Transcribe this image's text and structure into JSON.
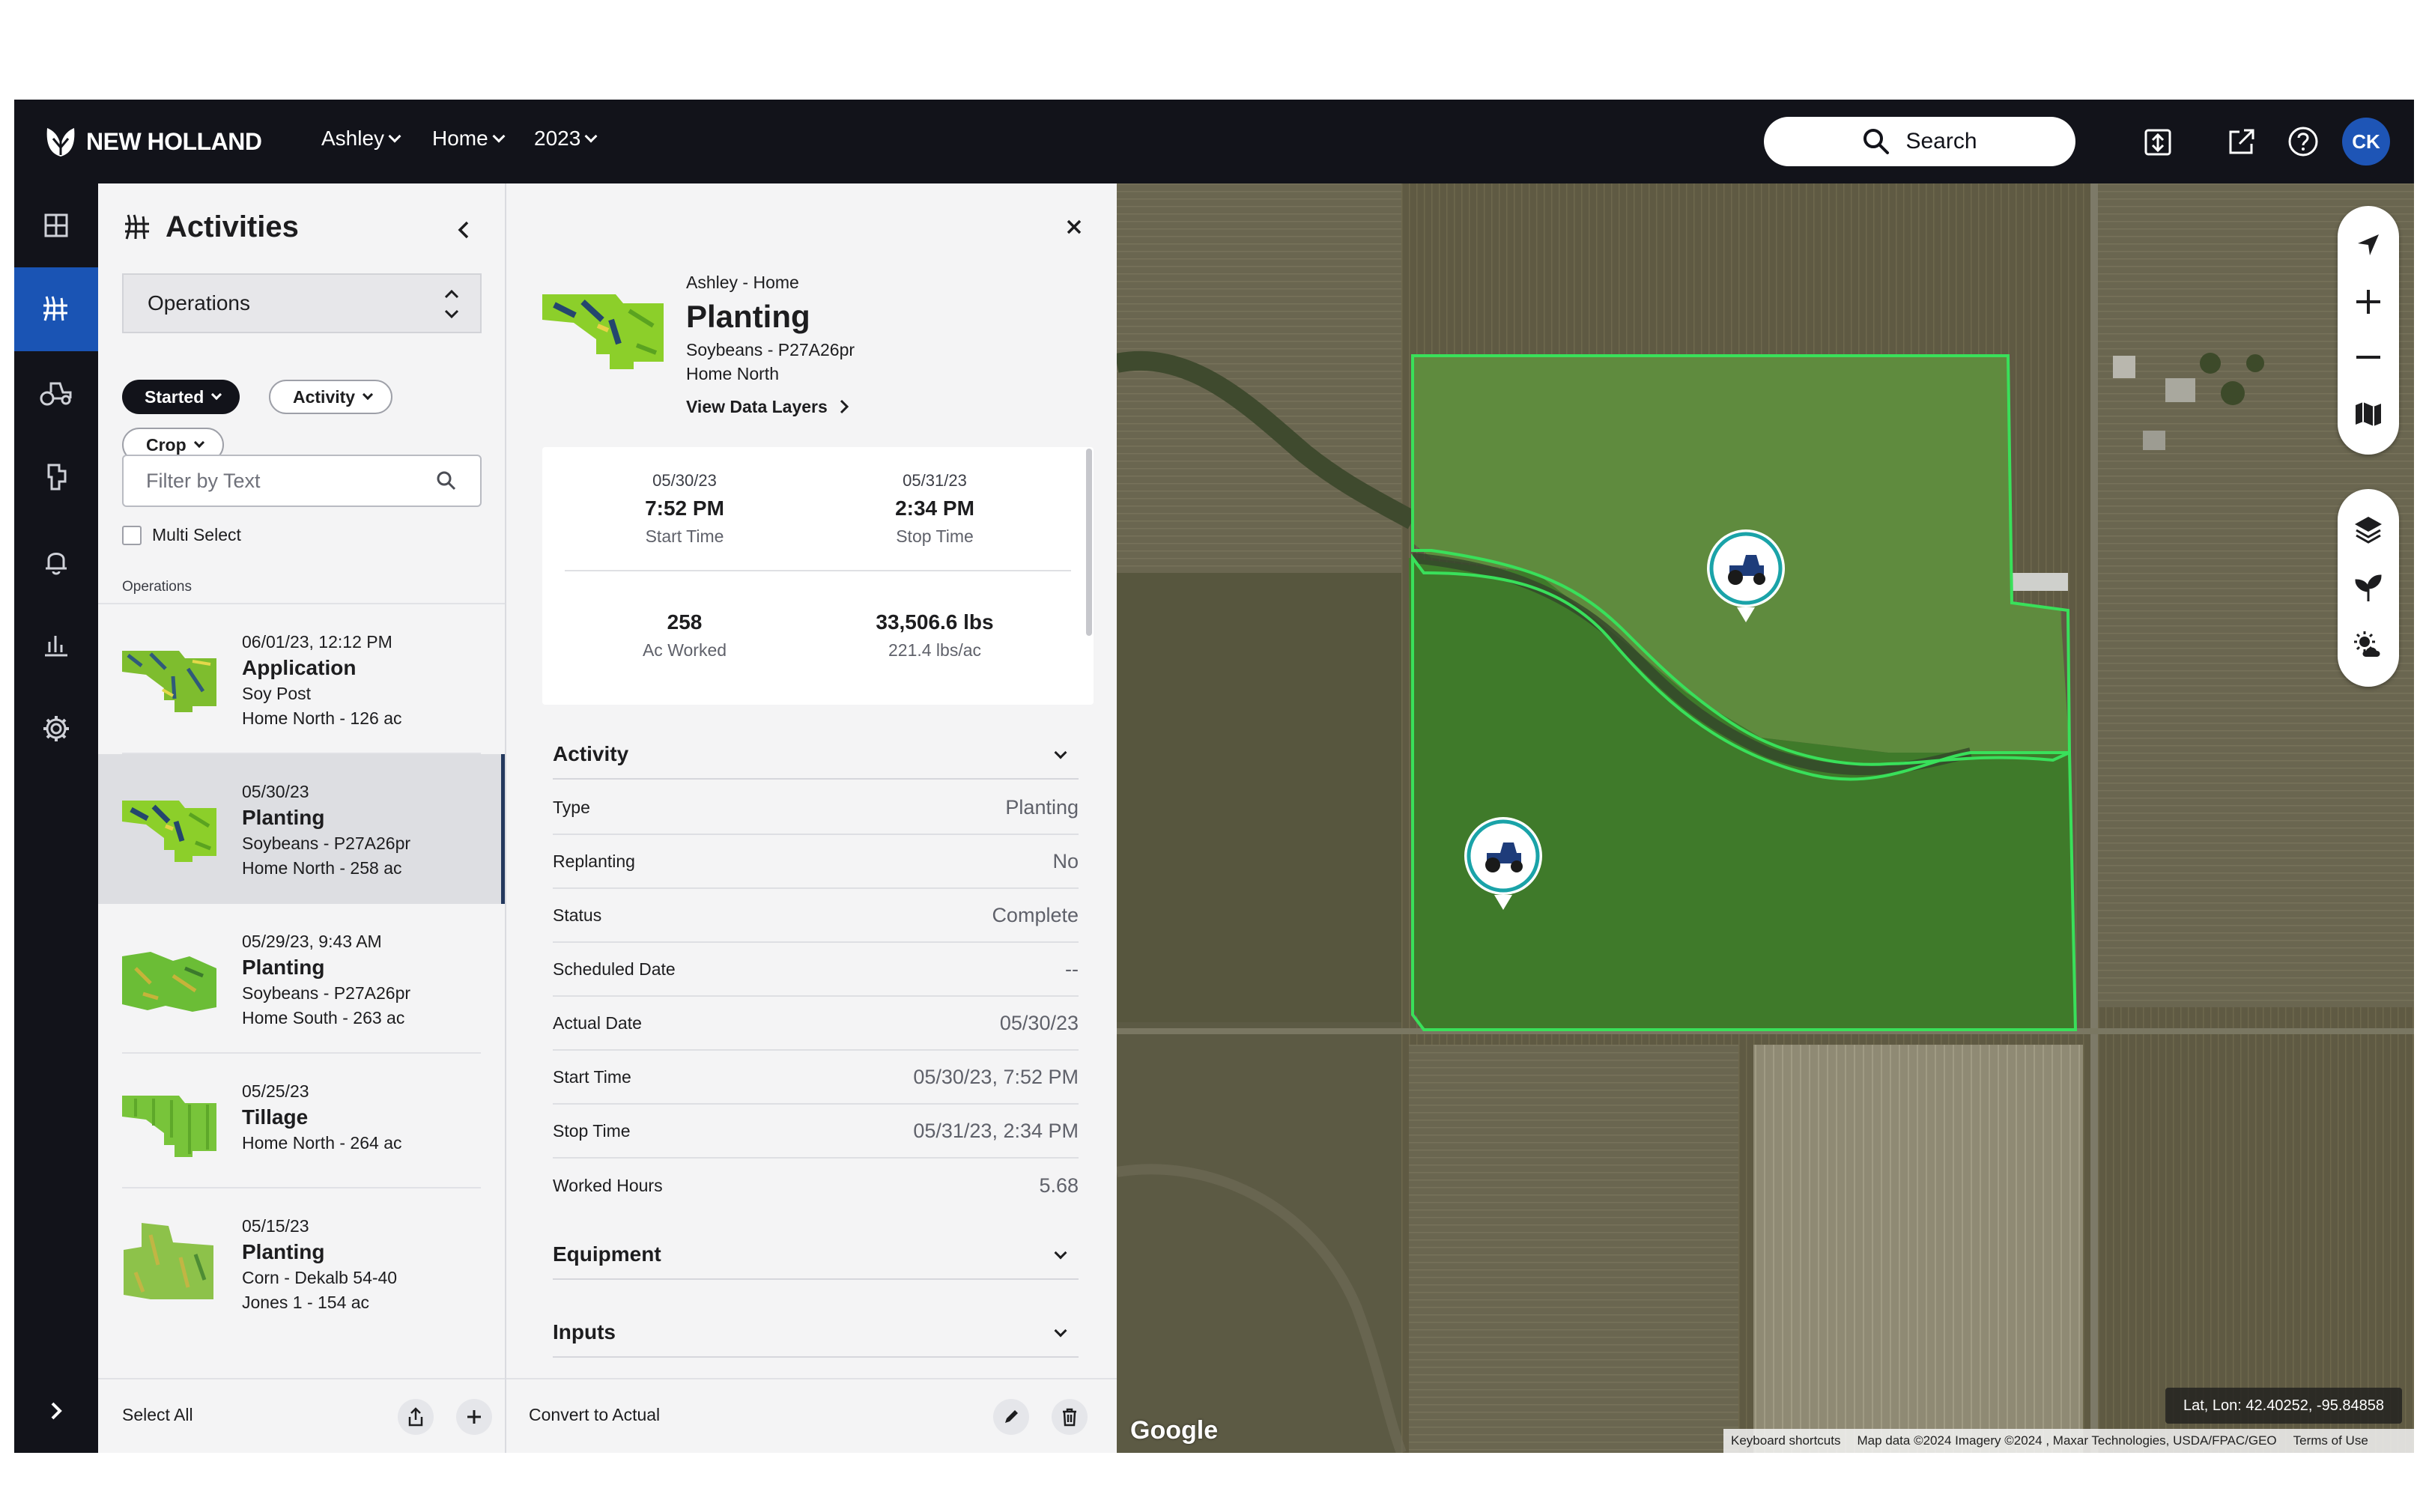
{
  "colors": {
    "topbar": "#12131a",
    "accent": "#1a54b4",
    "field_outline": "#39e05a"
  },
  "topbar": {
    "brand": "NEW HOLLAND",
    "nav": [
      {
        "label": "Ashley"
      },
      {
        "label": "Home"
      },
      {
        "label": "2023"
      }
    ],
    "search_label": "Search",
    "avatar_initials": "CK"
  },
  "rail": [
    "dashboard-icon",
    "activities-icon",
    "equipment-icon",
    "fields-icon",
    "notifications-icon",
    "reports-icon",
    "settings-icon",
    "expand-icon"
  ],
  "activities": {
    "title": "Activities",
    "select_value": "Operations",
    "chips": [
      "Started",
      "Activity",
      "Crop"
    ],
    "filter_placeholder": "Filter by Text",
    "multi_select": "Multi Select",
    "list_label": "Operations",
    "items": [
      {
        "date": "06/01/23, 12:12 PM",
        "name": "Application",
        "line1": "Soy Post",
        "line2": "Home North - 126 ac"
      },
      {
        "date": "05/30/23",
        "name": "Planting",
        "line1": "Soybeans - P27A26pr",
        "line2": "Home North - 258 ac"
      },
      {
        "date": "05/29/23, 9:43 AM",
        "name": "Planting",
        "line1": "Soybeans - P27A26pr",
        "line2": "Home South - 263 ac"
      },
      {
        "date": "05/25/23",
        "name": "Tillage",
        "line1": "Home North - 264 ac"
      },
      {
        "date": "05/15/23",
        "name": "Planting",
        "line1": "Corn - Dekalb 54-40",
        "line2": "Jones 1 - 154 ac"
      }
    ],
    "footer_select_all": "Select All"
  },
  "details": {
    "breadcrumb": "Ashley - Home",
    "title": "Planting",
    "subtitle": "Soybeans - P27A26pr",
    "field": "Home North",
    "view_layers": "View Data Layers",
    "stats": {
      "start_date": "05/30/23",
      "start_time": "7:52 PM",
      "start_label": "Start Time",
      "stop_date": "05/31/23",
      "stop_time": "2:34 PM",
      "stop_label": "Stop Time",
      "ac_worked": "258",
      "ac_label": "Ac Worked",
      "lbs": "33,506.6 lbs",
      "lbs_rate": "221.4 lbs/ac"
    },
    "activity_header": "Activity",
    "rows": [
      {
        "k": "Type",
        "v": "Planting"
      },
      {
        "k": "Replanting",
        "v": "No"
      },
      {
        "k": "Status",
        "v": "Complete"
      },
      {
        "k": "Scheduled Date",
        "v": "--"
      },
      {
        "k": "Actual Date",
        "v": "05/30/23"
      },
      {
        "k": "Start Time",
        "v": "05/30/23, 7:52 PM"
      },
      {
        "k": "Stop Time",
        "v": "05/31/23, 2:34 PM"
      },
      {
        "k": "Worked Hours",
        "v": "5.68"
      }
    ],
    "equipment_header": "Equipment",
    "inputs_header": "Inputs",
    "footer_convert": "Convert to Actual"
  },
  "map": {
    "google": "Google",
    "latlon": "Lat, Lon: 42.40252, -95.84858",
    "attribution": {
      "shortcuts": "Keyboard shortcuts",
      "data": "Map data ©2024 Imagery ©2024 , Maxar Technologies, USDA/FPAC/GEO",
      "terms": "Terms of Use"
    },
    "controls": [
      "navigate-icon",
      "zoom-in-icon",
      "zoom-out-icon",
      "map-type-icon",
      "layers-icon",
      "crop-icon",
      "weather-icon"
    ]
  }
}
